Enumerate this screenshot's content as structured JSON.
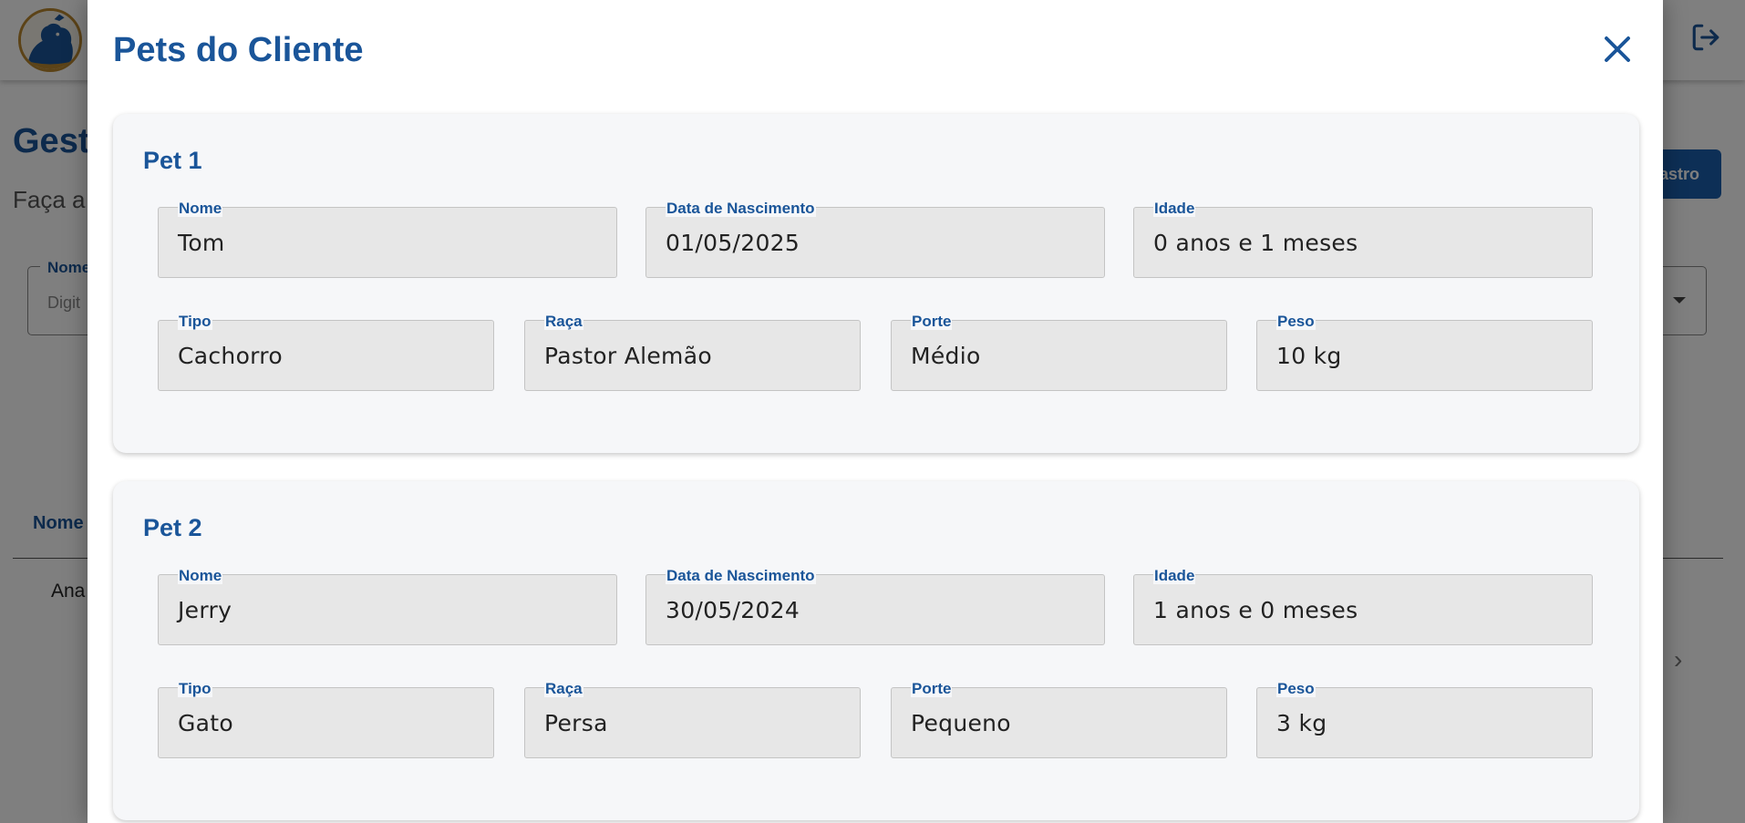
{
  "background": {
    "page_title": "Gest",
    "page_subtitle": "Faça a",
    "action_button": "astro",
    "filter_label": "Nome",
    "filter_placeholder": "Digit",
    "table_header_name": "Nome",
    "table_row_name": "Ana",
    "pagination_next": "›"
  },
  "modal": {
    "title": "Pets do Cliente",
    "close_icon": "close-icon",
    "pets": [
      {
        "title": "Pet 1",
        "fields": {
          "nome": {
            "label": "Nome",
            "value": "Tom"
          },
          "nascimento": {
            "label": "Data de Nascimento",
            "value": "01/05/2025"
          },
          "idade": {
            "label": "Idade",
            "value": "0 anos e 1 meses"
          },
          "tipo": {
            "label": "Tipo",
            "value": "Cachorro"
          },
          "raca": {
            "label": "Raça",
            "value": "Pastor Alemão"
          },
          "porte": {
            "label": "Porte",
            "value": "Médio"
          },
          "peso": {
            "label": "Peso",
            "value": "10 kg"
          }
        }
      },
      {
        "title": "Pet 2",
        "fields": {
          "nome": {
            "label": "Nome",
            "value": "Jerry"
          },
          "nascimento": {
            "label": "Data de Nascimento",
            "value": "30/05/2024"
          },
          "idade": {
            "label": "Idade",
            "value": "1 anos e 0 meses"
          },
          "tipo": {
            "label": "Tipo",
            "value": "Gato"
          },
          "raca": {
            "label": "Raça",
            "value": "Persa"
          },
          "porte": {
            "label": "Porte",
            "value": "Pequeno"
          },
          "peso": {
            "label": "Peso",
            "value": "3 kg"
          }
        }
      }
    ]
  },
  "colors": {
    "primary": "#1a5599",
    "button": "#1a5fad",
    "card_bg": "#f6f7f9",
    "field_bg": "#e7e7e7"
  }
}
